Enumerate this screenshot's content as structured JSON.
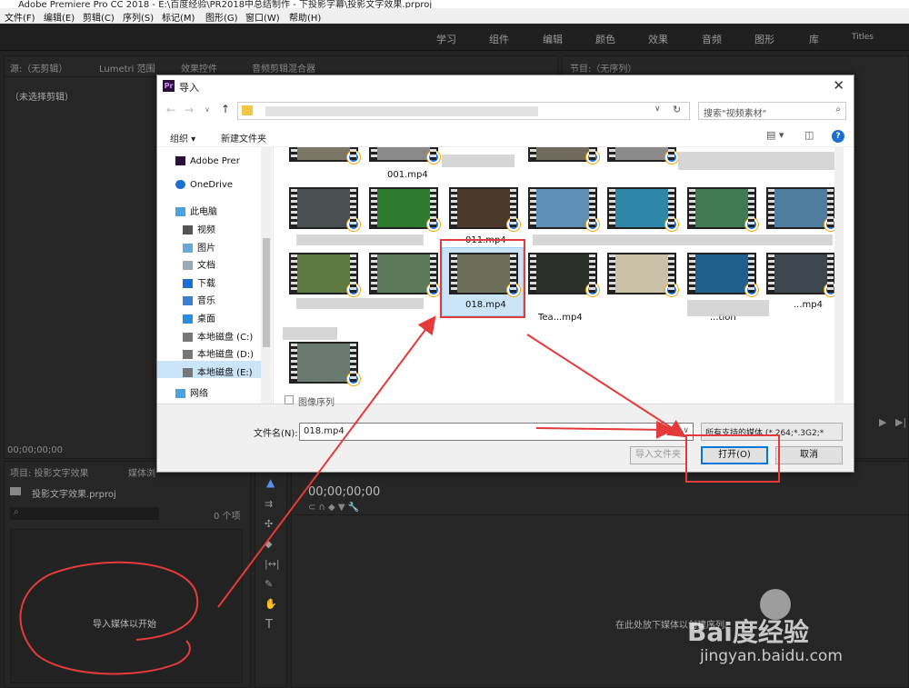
{
  "app_title": "Adobe Premiere Pro CC 2018 - E:\\百度经验\\PR2018中总结制作 - 下投影字幕\\投影文字效果.prproj",
  "menu": [
    "文件(F)",
    "编辑(E)",
    "剪辑(C)",
    "序列(S)",
    "标记(M)",
    "图形(G)",
    "窗口(W)",
    "帮助(H)"
  ],
  "workspaces": [
    "学习",
    "组件",
    "编辑",
    "颜色",
    "效果",
    "音频",
    "图形",
    "库",
    "Titles"
  ],
  "source_panel": {
    "tabs": [
      "源:（无剪辑）",
      "Lumetri 范围",
      "效果控件",
      "音频剪辑混合器"
    ],
    "no_clip": "（未选择剪辑）",
    "timecode": "00;00;00;00"
  },
  "program_panel": {
    "tab": "节目:（无序列）"
  },
  "project_panel": {
    "tabs": [
      "项目: 投影文字效果",
      "媒体浏"
    ],
    "file": "投影文字效果.prproj",
    "item_count": "0 个项",
    "empty_hint": "导入媒体以开始"
  },
  "timeline_panel": {
    "timecode": "00;00;00;00",
    "drop_hint": "在此处放下媒体以创建序列。"
  },
  "dialog": {
    "title": "导入",
    "search_placeholder": "搜索\"视频素材\"",
    "organize": "组织 ▾",
    "new_folder": "新建文件夹",
    "nav_items": [
      "Adobe Prer",
      "OneDrive",
      "此电脑",
      "视频",
      "图片",
      "文档",
      "下载",
      "音乐",
      "桌面",
      "本地磁盘 (C:)",
      "本地磁盘 (D:)",
      "本地磁盘 (E:)",
      "网络"
    ],
    "files": [
      "001.mp4",
      "011.mp4",
      "018.mp4",
      "Tea...mp4",
      "...tion",
      "...mp4"
    ],
    "image_sequence": "图像序列",
    "filename_label": "文件名(N):",
    "filename_value": "018.mp4",
    "filetype": "所有支持的媒体 (*.264;*.3G2;*",
    "import_folder_btn": "导入文件夹",
    "open_btn": "打开(O)",
    "cancel_btn": "取消"
  },
  "watermark": {
    "brand": "Bai度经验",
    "url": "jingyan.baidu.com"
  },
  "colors": {
    "accent_red": "#e53a3a",
    "dark_bg": "#232323",
    "play_blue": "#1b6fd0"
  }
}
